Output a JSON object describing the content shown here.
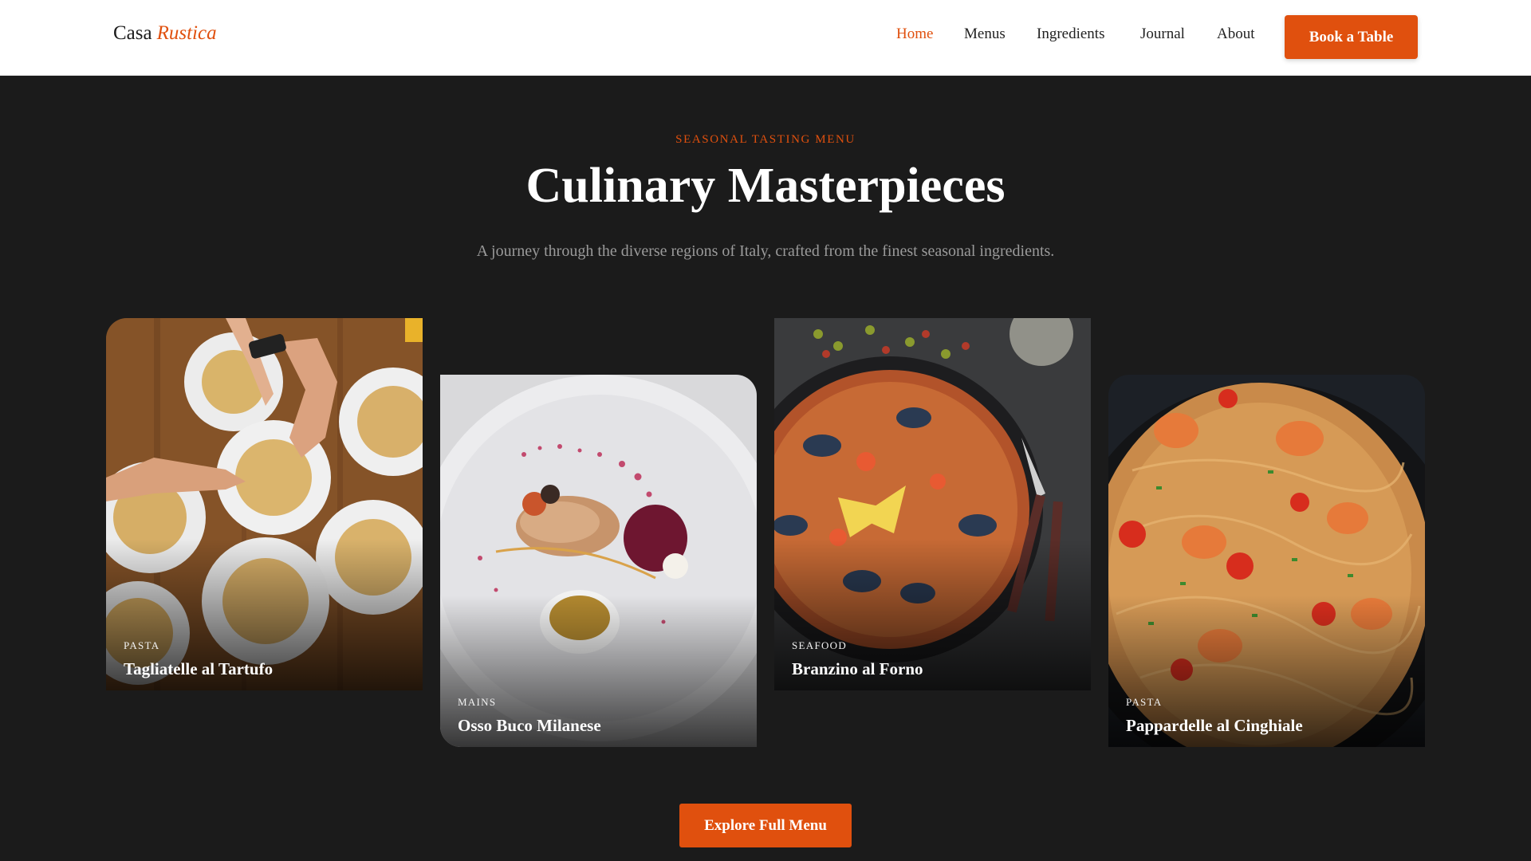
{
  "brand": {
    "name": "Casa",
    "accent": "Rustica"
  },
  "nav": {
    "items": [
      {
        "label": "Home",
        "active": true
      },
      {
        "label": "Menus",
        "active": false
      },
      {
        "label": "Ingredients",
        "active": false
      },
      {
        "label": "Journal",
        "active": false
      },
      {
        "label": "About",
        "active": false
      }
    ],
    "cta_label": "Book a Table"
  },
  "hero": {
    "eyebrow": "SEASONAL TASTING MENU",
    "title": "Culinary Masterpieces",
    "subtitle": "A journey through the diverse regions of Italy, crafted from the finest seasonal ingredients."
  },
  "dishes": [
    {
      "category": "PASTA",
      "name": "Tagliatelle al Tartufo"
    },
    {
      "category": "MAINS",
      "name": "Osso Buco Milanese"
    },
    {
      "category": "SEAFOOD",
      "name": "Branzino al Forno"
    },
    {
      "category": "PASTA",
      "name": "Pappardelle al Cinghiale"
    }
  ],
  "footer": {
    "cta_label": "Explore Full Menu"
  },
  "colors": {
    "accent": "#e0500e",
    "background": "#1b1b1b",
    "header": "#ffffff"
  }
}
